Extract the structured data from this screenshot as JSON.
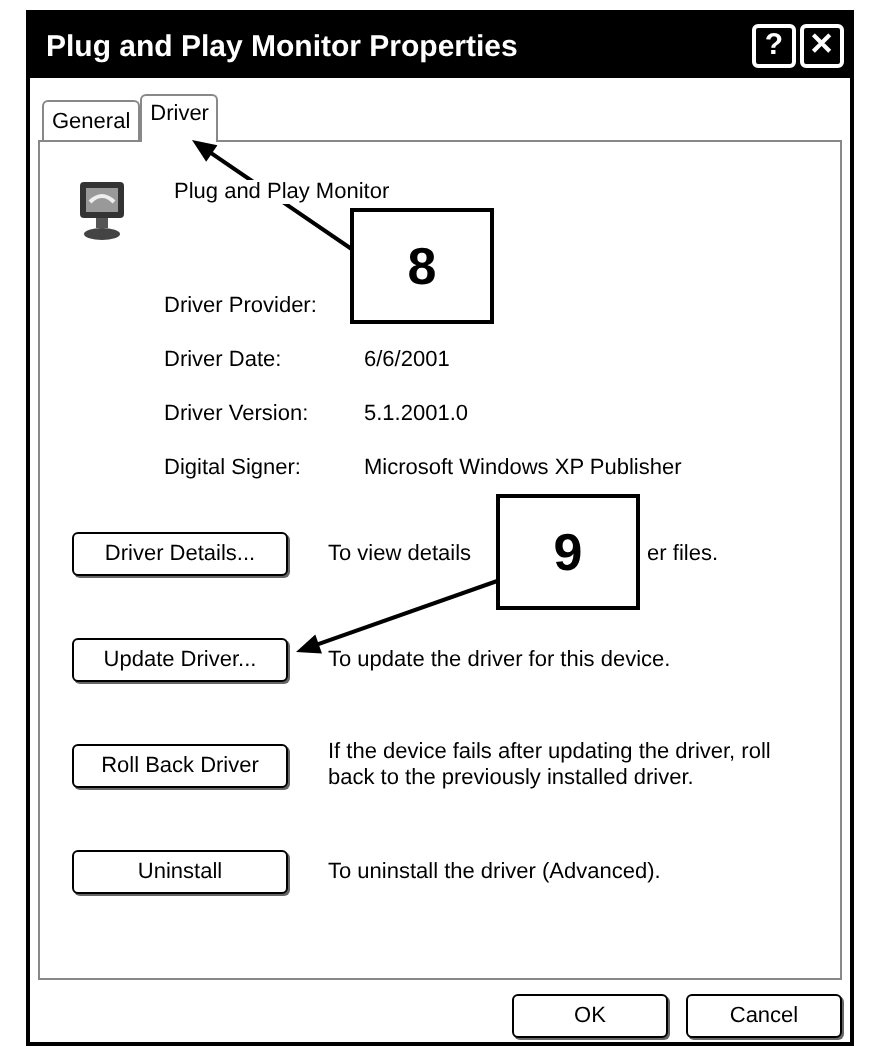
{
  "window": {
    "title": "Plug and Play Monitor Properties",
    "help_button": "?",
    "close_button": "✕"
  },
  "tabs": [
    {
      "label": "General",
      "selected": false
    },
    {
      "label": "Driver",
      "selected": true
    }
  ],
  "device": {
    "name": "Plug and Play Monitor"
  },
  "details": [
    {
      "label": "Driver Provider:"
    },
    {
      "label": "Driver Date:",
      "value": "6/6/2001"
    },
    {
      "label": "Driver Version:",
      "value": "5.1.2001.0"
    },
    {
      "label": "Digital Signer:",
      "value": "Microsoft Windows XP Publisher"
    }
  ],
  "actions": [
    {
      "button": "Driver Details...",
      "description_parts": [
        "To view details",
        "er files."
      ]
    },
    {
      "button": "Update Driver...",
      "description_parts": [
        "To update the driver for this device."
      ]
    },
    {
      "button": "Roll Back Driver",
      "description_parts": [
        "If the device fails after updating the driver, roll back to the previously installed driver."
      ]
    },
    {
      "button": "Uninstall",
      "description_parts": [
        "To uninstall the driver (Advanced)."
      ]
    }
  ],
  "footer_buttons": [
    "OK",
    "Cancel"
  ],
  "callouts": [
    {
      "number": "8"
    },
    {
      "number": "9"
    }
  ]
}
